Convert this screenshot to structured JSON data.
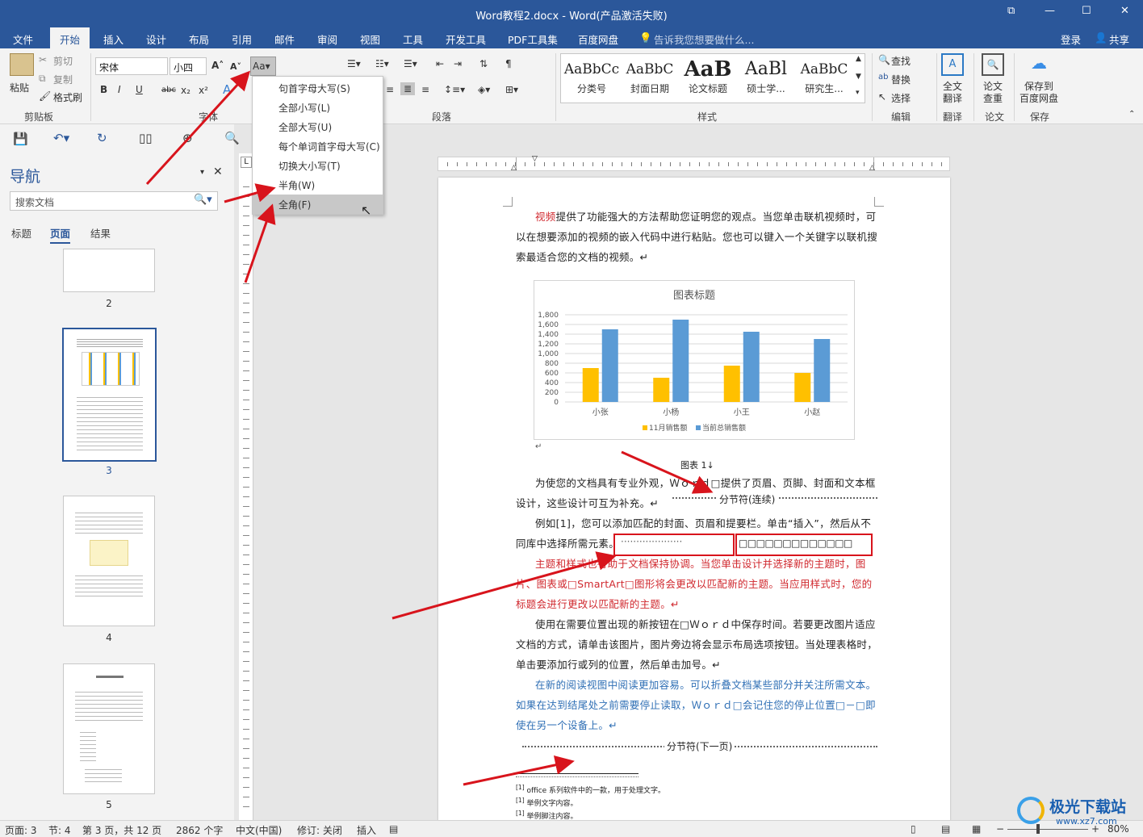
{
  "window": {
    "title": "Word教程2.docx - Word(产品激活失败)"
  },
  "tabs": [
    "文件",
    "开始",
    "插入",
    "设计",
    "布局",
    "引用",
    "邮件",
    "审阅",
    "视图",
    "工具",
    "开发工具",
    "PDF工具集",
    "百度网盘"
  ],
  "tell_me": "告诉我您想要做什么...",
  "account": {
    "login": "登录",
    "share": "共享"
  },
  "ribbon": {
    "clipboard": {
      "paste": "粘贴",
      "cut": "剪切",
      "copy": "复制",
      "format_painter": "格式刷",
      "label": "剪贴板"
    },
    "font": {
      "name": "宋体",
      "size": "小四",
      "label": "字体",
      "change_case_btn": "Aa"
    },
    "paragraph": {
      "label": "段落"
    },
    "styles": {
      "label": "样式",
      "items": [
        {
          "preview": "AaBbCc",
          "name": "分类号"
        },
        {
          "preview": "AaBbC",
          "name": "封面日期"
        },
        {
          "preview": "AaB",
          "name": "论文标题"
        },
        {
          "preview": "AaBl",
          "name": "硕士学..."
        },
        {
          "preview": "AaBbC",
          "name": "研究生..."
        }
      ]
    },
    "editing": {
      "find": "查找",
      "replace": "替换",
      "select": "选择",
      "label": "编辑"
    },
    "translate": {
      "btn": "全文\n翻译",
      "label": "翻译"
    },
    "paper": {
      "btn": "论文\n查重",
      "label": "论文"
    },
    "save": {
      "btn": "保存到\n百度网盘",
      "label": "保存"
    }
  },
  "change_case_menu": [
    "句首字母大写(S)",
    "全部小写(L)",
    "全部大写(U)",
    "每个单词首字母大写(C)",
    "切换大小写(T)",
    "半角(W)",
    "全角(F)"
  ],
  "nav": {
    "title": "导航",
    "search_placeholder": "搜索文档",
    "tabs": [
      "标题",
      "页面",
      "结果"
    ],
    "pages": [
      "2",
      "3",
      "4",
      "5"
    ]
  },
  "chart_data": {
    "type": "bar",
    "title": "图表标题",
    "categories": [
      "小张",
      "小杨",
      "小王",
      "小赵"
    ],
    "series": [
      {
        "name": "11月销售额",
        "values": [
          700,
          500,
          750,
          600
        ],
        "color": "#ffc000"
      },
      {
        "name": "当前总销售额",
        "values": [
          1500,
          1700,
          1450,
          1300
        ],
        "color": "#5b9bd5"
      }
    ],
    "yticks": [
      "1,800",
      "1,600",
      "1,400",
      "1,200",
      "1,000",
      "800",
      "600",
      "400",
      "200",
      "0"
    ],
    "ylim": [
      0,
      1800
    ],
    "legend": "bottom",
    "grid": true
  },
  "document": {
    "p1": "提供了功能强大的方法帮助您证明您的观点。当您单击联机视频时，可以在想要添加的视频的嵌入代码中进行粘贴。您也可以键入一个关键字以联机搜索最适合您的文档的视频。↵",
    "p1_lead": "视频",
    "caption": "图表 1↓",
    "p2": "为使您的文档具有专业外观，Ｗｏｒｄ□提供了页眉、页脚、封面和文本框设计，这些设计可互为补充。↵",
    "section_cont": "分节符(连续)",
    "p3a": "例如[1]，您可以添加匹配的封面、页眉和提要栏。单击“插入”，然后从不同库中选择所需元素。",
    "dots": "····················",
    "boxes": "□□□□□□□□□□□□□",
    "p4": "主题和样式也有助于文档保持协调。当您单击设计并选择新的主题时，图片、图表或□SmartArt□图形将会更改以匹配新的主题。当应用样式时，您的标题会进行更改以匹配新的主题。↵",
    "p5": "使用在需要位置出现的新按钮在□Ｗｏｒｄ中保存时间。若要更改图片适应文档的方式，请单击该图片，图片旁边将会显示布局选项按钮。当处理表格时，单击要添加行或列的位置，然后单击加号。↵",
    "p6": "在新的阅读视图中阅读更加容易。可以折叠文档某些部分并关注所需文本。如果在达到结尾处之前需要停止读取，Ｗｏｒｄ□会记住您的停止位置□－□即使在另一个设备上。↵",
    "section_next": "分节符(下一页)",
    "fn1": "office 系列软件中的一款，用于处理文字。",
    "fn2": "举例文字内容。",
    "fn3": "举例脚注内容。"
  },
  "status": {
    "page": "页面: 3",
    "section": "节: 4",
    "pages": "第 3 页，共 12 页",
    "words": "2862 个字",
    "lang": "中文(中国)",
    "track": "修订: 关闭",
    "insert": "插入",
    "zoom": "80%"
  },
  "watermark": {
    "text": "极光下载站",
    "url": "www.xz7.com"
  }
}
